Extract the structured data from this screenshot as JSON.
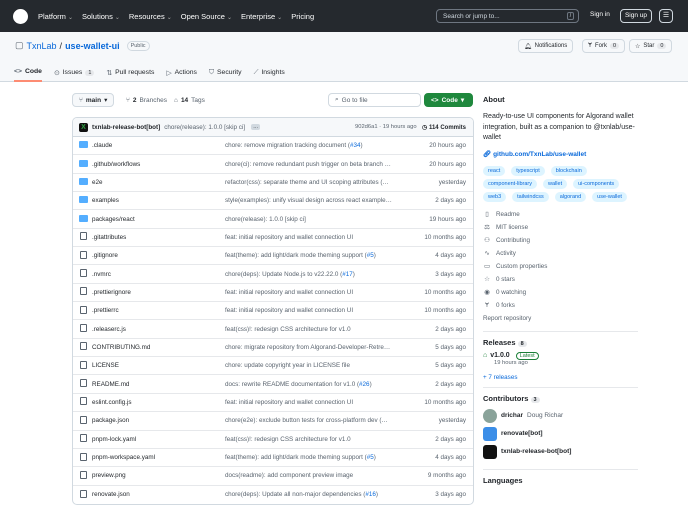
{
  "header": {
    "nav": [
      "Platform",
      "Solutions",
      "Resources",
      "Open Source",
      "Enterprise",
      "Pricing"
    ],
    "search_placeholder": "Search or jump to...",
    "slash": "/",
    "sign_in": "Sign in",
    "sign_up": "Sign up"
  },
  "repo": {
    "owner": "TxnLab",
    "name": "use-wallet-ui",
    "visibility": "Public",
    "notifications": "Notifications",
    "fork": "Fork",
    "fork_count": "0",
    "star": "Star",
    "star_count": "0"
  },
  "tabs": [
    {
      "label": "Code"
    },
    {
      "label": "Issues",
      "count": "1"
    },
    {
      "label": "Pull requests"
    },
    {
      "label": "Actions"
    },
    {
      "label": "Security"
    },
    {
      "label": "Insights"
    }
  ],
  "toolbar": {
    "branch": "main",
    "branches": "2",
    "branches_label": "Branches",
    "tags": "14",
    "tags_label": "Tags",
    "go_to_file": "Go to file",
    "code": "Code"
  },
  "commit": {
    "author": "txnlab-release-bot[bot]",
    "message": "chore(release): 1.0.0 [skip ci]",
    "sha_time": "902d6a1 · 19 hours ago",
    "commits": "114 Commits"
  },
  "files": [
    {
      "name": ".claude",
      "type": "dir",
      "msg": "chore: remove migration tracking document (",
      "pr": "#34",
      "after": ")",
      "age": "20 hours ago"
    },
    {
      "name": ".github/workflows",
      "type": "dir",
      "msg": "chore(ci): remove redundant push trigger on beta branch …",
      "age": "20 hours ago"
    },
    {
      "name": "e2e",
      "type": "dir",
      "msg": "refactor(css): separate theme and UI scoping attributes (…",
      "age": "yesterday"
    },
    {
      "name": "examples",
      "type": "dir",
      "msg": "style(examples): unify visual design across react example…",
      "age": "2 days ago"
    },
    {
      "name": "packages/react",
      "type": "dir",
      "msg": "chore(release): 1.0.0 [skip ci]",
      "age": "19 hours ago"
    },
    {
      "name": ".gitattributes",
      "type": "file",
      "msg": "feat: initial repository and wallet connection UI",
      "age": "10 months ago"
    },
    {
      "name": ".gitignore",
      "type": "file",
      "msg": "feat(theme): add light/dark mode theming support (",
      "pr": "#5",
      "after": ")",
      "age": "4 days ago"
    },
    {
      "name": ".nvmrc",
      "type": "file",
      "msg": "chore(deps): Update Node.js to v22.22.0 (",
      "pr": "#17",
      "after": ")",
      "age": "3 days ago"
    },
    {
      "name": ".prettierignore",
      "type": "file",
      "msg": "feat: initial repository and wallet connection UI",
      "age": "10 months ago"
    },
    {
      "name": ".prettierrc",
      "type": "file",
      "msg": "feat: initial repository and wallet connection UI",
      "age": "10 months ago"
    },
    {
      "name": ".releaserc.js",
      "type": "file",
      "msg": "feat(css)!: redesign CSS architecture for v1.0",
      "age": "2 days ago"
    },
    {
      "name": "CONTRIBUTING.md",
      "type": "file",
      "msg": "chore: migrate repository from Algorand-Developer-Retre…",
      "age": "5 days ago"
    },
    {
      "name": "LICENSE",
      "type": "file",
      "msg": "chore: update copyright year in LICENSE file",
      "age": "5 days ago"
    },
    {
      "name": "README.md",
      "type": "file",
      "msg": "docs: rewrite README documentation for v1.0 (",
      "pr": "#26",
      "after": ")",
      "age": "2 days ago"
    },
    {
      "name": "eslint.config.js",
      "type": "file",
      "msg": "feat: initial repository and wallet connection UI",
      "age": "10 months ago"
    },
    {
      "name": "package.json",
      "type": "file",
      "msg": "chore(e2e): exclude button tests for cross-platform dev (…",
      "age": "yesterday"
    },
    {
      "name": "pnpm-lock.yaml",
      "type": "file",
      "msg": "feat(css)!: redesign CSS architecture for v1.0",
      "age": "2 days ago"
    },
    {
      "name": "pnpm-workspace.yaml",
      "type": "file",
      "msg": "feat(theme): add light/dark mode theming support (",
      "pr": "#5",
      "after": ")",
      "age": "4 days ago"
    },
    {
      "name": "preview.png",
      "type": "file",
      "msg": "docs(readme): add component preview image",
      "age": "9 months ago"
    },
    {
      "name": "renovate.json",
      "type": "file",
      "msg": "chore(deps): Update all non-major dependencies (",
      "pr": "#16",
      "after": ")",
      "age": "3 days ago"
    }
  ],
  "about": {
    "title": "About",
    "description": "Ready-to-use UI components for Algorand wallet integration, built as a companion to @txnlab/use-wallet",
    "link": "github.com/TxnLab/use-wallet",
    "topics": [
      "react",
      "typescript",
      "blockchain",
      "component-library",
      "wallet",
      "ui-components",
      "web3",
      "tailwindcss",
      "algorand",
      "use-wallet"
    ],
    "meta": [
      {
        "icon": "book-icon",
        "glyph": "▯",
        "label": "Readme"
      },
      {
        "icon": "scale-icon",
        "glyph": "⚖",
        "label": "MIT license"
      },
      {
        "icon": "people-icon",
        "glyph": "⚇",
        "label": "Contributing"
      },
      {
        "icon": "pulse-icon",
        "glyph": "∿",
        "label": "Activity"
      },
      {
        "icon": "note-icon",
        "glyph": "▭",
        "label": "Custom properties"
      },
      {
        "icon": "star-icon",
        "glyph": "☆",
        "label": "0 stars"
      },
      {
        "icon": "eye-icon",
        "glyph": "◉",
        "label": "0 watching"
      },
      {
        "icon": "fork-icon",
        "glyph": "Ɏ",
        "label": "0 forks"
      }
    ],
    "report": "Report repository"
  },
  "releases": {
    "title": "Releases",
    "count": "8",
    "tag": "v1.0.0",
    "latest": "Latest",
    "time": "19 hours ago",
    "more": "+ 7 releases"
  },
  "contributors": {
    "title": "Contributors",
    "count": "3",
    "list": [
      {
        "login": "drichar",
        "name": "Doug Richar",
        "color": "#8aa39a"
      },
      {
        "login": "renovate[bot]",
        "name": "",
        "color": "#3b8ee8"
      },
      {
        "login": "txnlab-release-bot[bot]",
        "name": "",
        "color": "#111111"
      }
    ]
  },
  "languages": {
    "title": "Languages"
  }
}
